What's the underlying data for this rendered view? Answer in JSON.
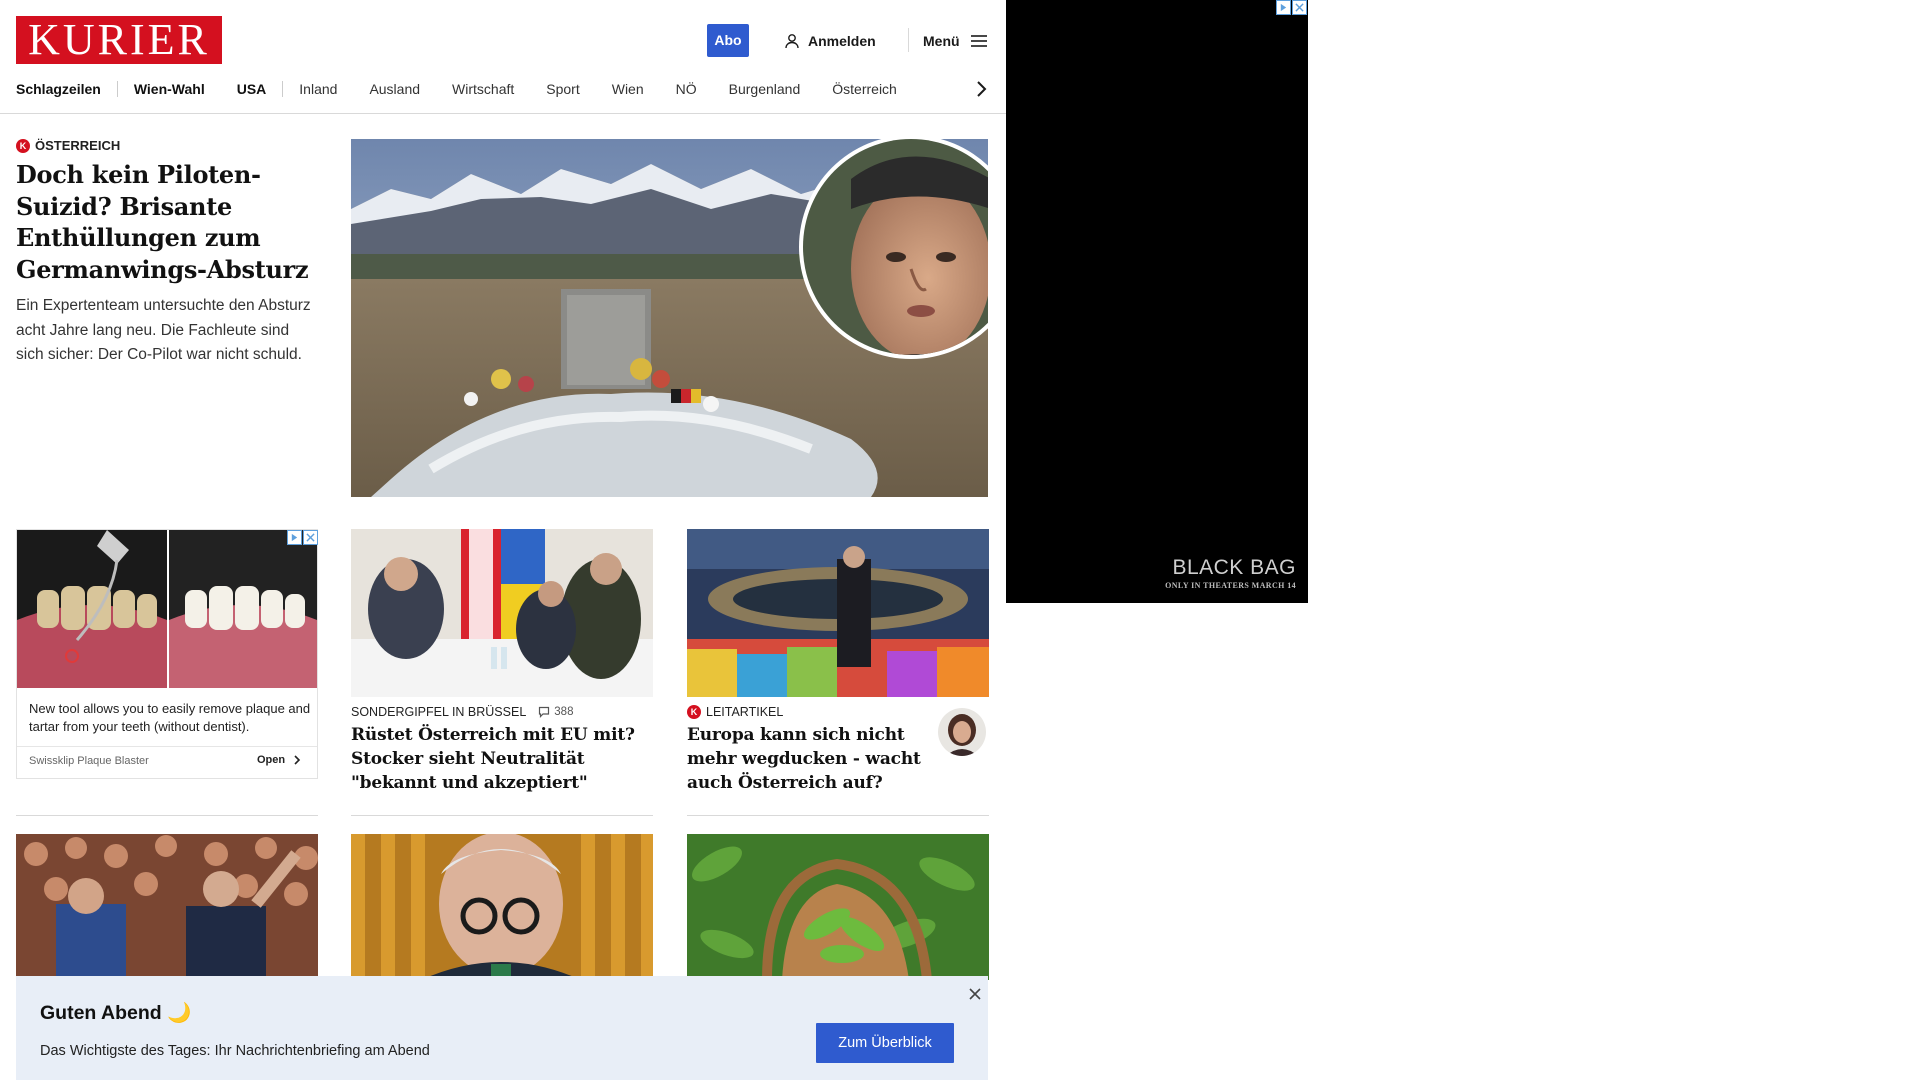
{
  "header": {
    "logo_text": "KURIER",
    "abo_label": "Abo",
    "login_label": "Anmelden",
    "menu_label": "Menü"
  },
  "nav": {
    "items": [
      "Schlagzeilen",
      "Wien-Wahl",
      "USA",
      "Inland",
      "Ausland",
      "Wirtschaft",
      "Sport",
      "Wien",
      "NÖ",
      "Burgenland",
      "Österreich"
    ]
  },
  "hero": {
    "badge": "K",
    "kicker": "Österreich",
    "title": "Doch kein Piloten-Suizid? Brisante Enthüllungen zum Germanwings-Absturz",
    "lead": "Ein Expertenteam untersuchte den Absturz acht Jahre lang neu. Die Fachleute sind sich sicher: Der Co-Pilot war nicht schuld."
  },
  "ad_card": {
    "text": "New tool allows you to easily remove plaque and tartar from your teeth (without dentist).",
    "brand": "Swissklip Plaque Blaster",
    "open_label": "Open"
  },
  "cards": [
    {
      "kicker": "Sondergipfel in Brüssel",
      "comments": "388",
      "title": "Rüstet Österreich mit EU mit? Stocker sieht Neutralität \"bekannt und akzeptiert\""
    },
    {
      "badge": "K",
      "kicker": "Leitartikel",
      "title": "Europa kann sich nicht mehr wegducken - wacht auch Österreich auf?"
    }
  ],
  "side_ad": {
    "title": "BLACK BAG",
    "subtitle": "ONLY IN THEATERS MARCH 14"
  },
  "banner": {
    "title": "Guten Abend 🌙",
    "text": "Das Wichtigste des Tages: Ihr Nachrichtenbriefing am Abend",
    "button": "Zum Überblick"
  },
  "colors": {
    "brand_red": "#d4101f",
    "accent_blue": "#2f5bcf",
    "banner_bg": "#e8eef7"
  }
}
